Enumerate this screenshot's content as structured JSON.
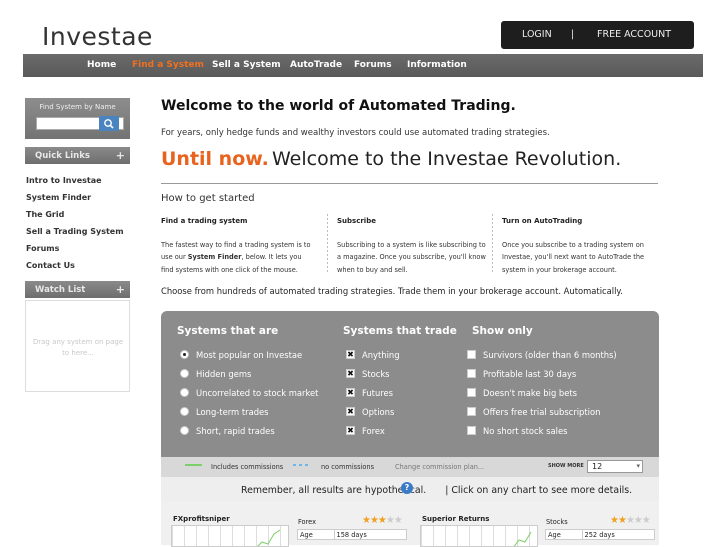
{
  "header": {
    "logo": "Investae",
    "login": "LOGIN",
    "separator": "|",
    "free_account": "FREE ACCOUNT"
  },
  "nav": {
    "items": [
      "Home",
      "Find a System",
      "Sell a System",
      "AutoTrade",
      "Forums",
      "Information"
    ],
    "active": "Find a System",
    "active_color": "#f07020"
  },
  "sidebar": {
    "search_label": "Find System by Name",
    "search_value": "",
    "quick_links_title": "Quick Links",
    "quick_links": [
      "Intro to Investae",
      "System Finder",
      "The Grid",
      "Sell a Trading System",
      "Forums",
      "Contact Us"
    ],
    "watch_list_title": "Watch List",
    "watch_list_hint": "Drag any system on page to here...",
    "plus": "+"
  },
  "main": {
    "welcome": "Welcome to the world of Automated Trading.",
    "intro": "For years, only hedge funds and wealthy investors could use automated trading strategies.",
    "until_now": "Until now.",
    "revolution": "Welcome to the Investae Revolution.",
    "how_to": "How to get started",
    "columns": [
      {
        "title": "Find a trading system",
        "text_before": "The fastest way to find a trading system is to use our ",
        "text_bold": "System Finder",
        "text_after": ", below. It lets you find systems with one click of the mouse."
      },
      {
        "title": "Subscribe",
        "text": "Subscribing to a system is like subscribing to a magazine. Once you subscribe, you'll know when to buy and sell."
      },
      {
        "title": "Turn on AutoTrading",
        "text": "Once you subscribe to a trading system on Investae, you'll next want to AutoTrade the system in your brokerage account."
      }
    ],
    "choose": "Choose from hundreds of automated trading strategies. Trade them in your brokerage account. Automatically."
  },
  "filters": {
    "col1_title": "Systems that are",
    "col2_title": "Systems that trade",
    "col3_title": "Show only",
    "col1": [
      {
        "label": "Most popular on Investae",
        "selected": true
      },
      {
        "label": "Hidden gems",
        "selected": false
      },
      {
        "label": "Uncorrelated to stock market",
        "selected": false
      },
      {
        "label": "Long-term trades",
        "selected": false
      },
      {
        "label": "Short, rapid trades",
        "selected": false
      }
    ],
    "col2": [
      {
        "label": "Anything",
        "checked": true
      },
      {
        "label": "Stocks",
        "checked": true
      },
      {
        "label": "Futures",
        "checked": true
      },
      {
        "label": "Options",
        "checked": true
      },
      {
        "label": "Forex",
        "checked": true
      }
    ],
    "col3": [
      {
        "label": "Survivors (older than 6 months)",
        "checked": false
      },
      {
        "label": "Profitable last 30 days",
        "checked": false
      },
      {
        "label": "Doesn't make big bets",
        "checked": false
      },
      {
        "label": "Offers free trial subscription",
        "checked": false
      },
      {
        "label": "No short stock sales",
        "checked": false
      }
    ],
    "check_mark": "✖"
  },
  "legend": {
    "includes": "Includes commissions",
    "no_comm": "no commissions",
    "change": "Change commission plan...",
    "show_more_label": "SHOW MORE",
    "show_more_value": "12"
  },
  "remember": {
    "before": "Remember, all results are hypothetical.",
    "help": "?",
    "after": " | Click on any chart to see more details."
  },
  "results": [
    {
      "name": "FXprofitsniper",
      "category": "Forex",
      "stars": 3,
      "rows": [
        [
          "Age",
          "158 days"
        ]
      ]
    },
    {
      "name": "Superior Returns",
      "category": "Stocks",
      "stars": 2,
      "rows": [
        [
          "Age",
          "252 days"
        ]
      ]
    }
  ]
}
